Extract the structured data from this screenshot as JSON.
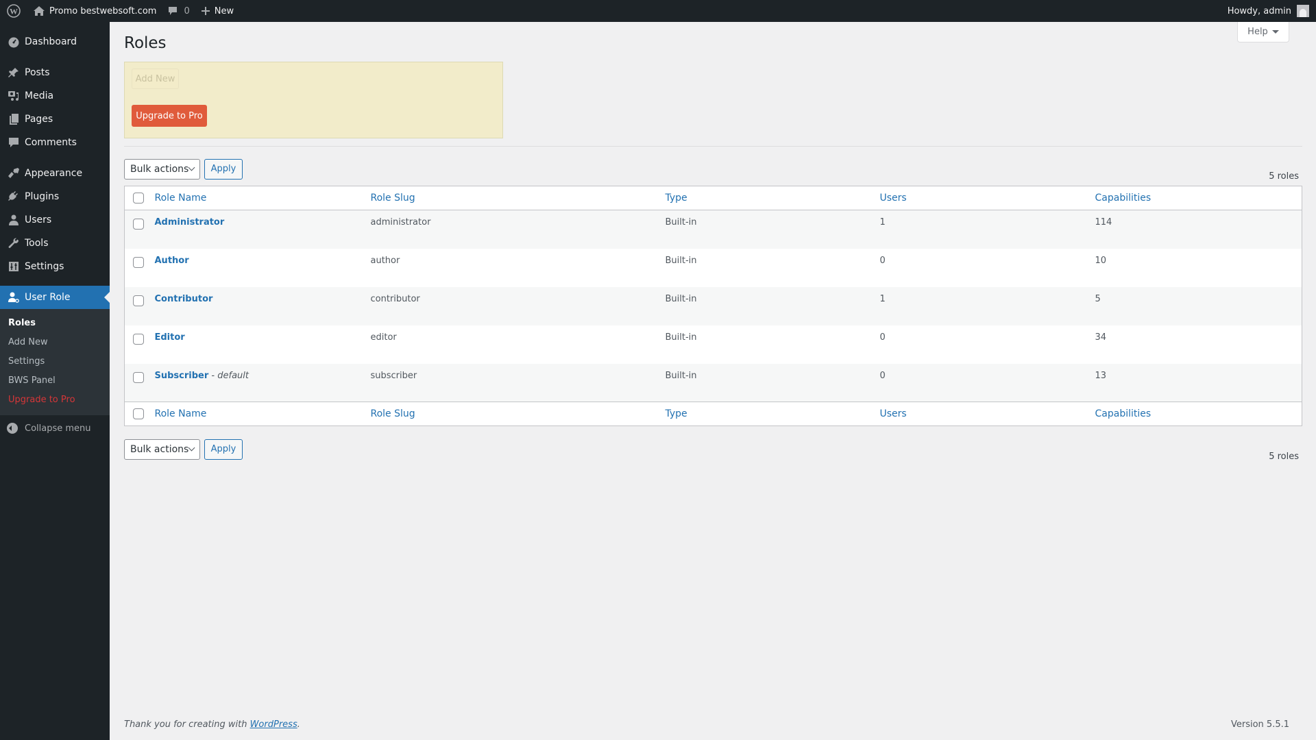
{
  "adminbar": {
    "site_name": "Promo bestwebsoft.com",
    "comments_count": "0",
    "new_label": "New",
    "howdy": "Howdy, admin"
  },
  "sidebar": {
    "items": [
      {
        "label": "Dashboard",
        "icon": "dashboard-icon"
      },
      {
        "label": "Posts",
        "icon": "pin-icon"
      },
      {
        "label": "Media",
        "icon": "media-icon"
      },
      {
        "label": "Pages",
        "icon": "pages-icon"
      },
      {
        "label": "Comments",
        "icon": "comment-icon"
      },
      {
        "label": "Appearance",
        "icon": "brush-icon"
      },
      {
        "label": "Plugins",
        "icon": "plugin-icon"
      },
      {
        "label": "Users",
        "icon": "user-icon"
      },
      {
        "label": "Tools",
        "icon": "wrench-icon"
      },
      {
        "label": "Settings",
        "icon": "sliders-icon"
      },
      {
        "label": "User Role",
        "icon": "user-role-icon"
      }
    ],
    "submenu": [
      "Roles",
      "Add New",
      "Settings",
      "BWS Panel",
      "Upgrade to Pro"
    ],
    "collapse": "Collapse menu"
  },
  "page": {
    "title": "Roles",
    "help": "Help",
    "add_new": "Add New",
    "upgrade": "Upgrade to Pro",
    "bulk_actions": "Bulk actions",
    "apply": "Apply",
    "count": "5 roles"
  },
  "table": {
    "columns": [
      "Role Name",
      "Role Slug",
      "Type",
      "Users",
      "Capabilities"
    ],
    "rows": [
      {
        "name": "Administrator",
        "note": "",
        "slug": "administrator",
        "type": "Built-in",
        "users": "1",
        "capabilities": "114"
      },
      {
        "name": "Author",
        "note": "",
        "slug": "author",
        "type": "Built-in",
        "users": "0",
        "capabilities": "10"
      },
      {
        "name": "Contributor",
        "note": "",
        "slug": "contributor",
        "type": "Built-in",
        "users": "1",
        "capabilities": "5"
      },
      {
        "name": "Editor",
        "note": "",
        "slug": "editor",
        "type": "Built-in",
        "users": "0",
        "capabilities": "34"
      },
      {
        "name": "Subscriber",
        "note": "default",
        "slug": "subscriber",
        "type": "Built-in",
        "users": "0",
        "capabilities": "13"
      }
    ]
  },
  "footer": {
    "thanks_prefix": "Thank you for creating with ",
    "thanks_link": "WordPress",
    "thanks_suffix": ".",
    "version": "Version 5.5.1"
  }
}
